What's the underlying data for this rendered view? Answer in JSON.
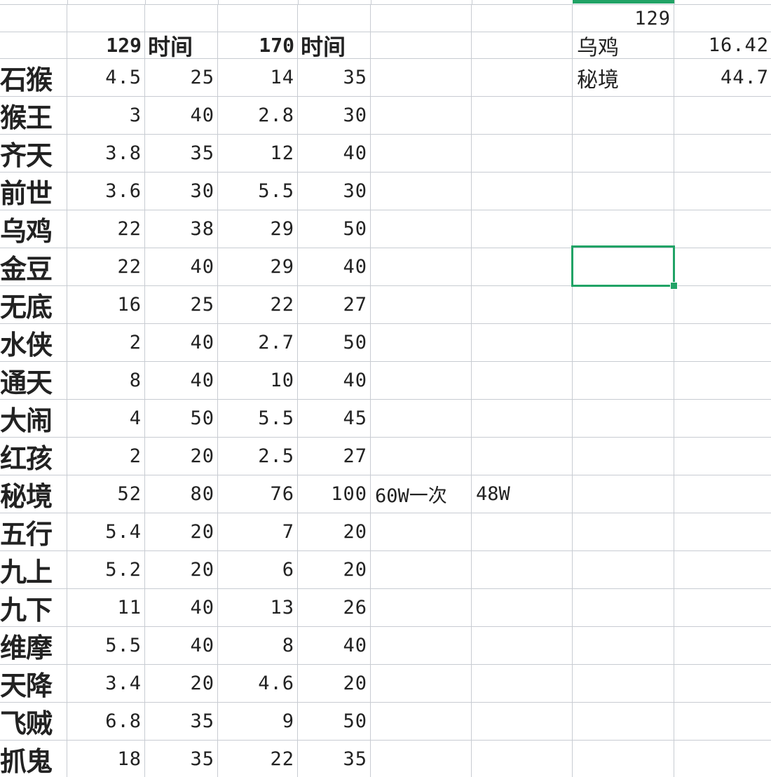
{
  "top_row": {
    "g1": "129"
  },
  "header": {
    "b": "129",
    "c": "时间",
    "d": "170",
    "e": "时间",
    "g_label": "乌鸡",
    "h_value": "16.42"
  },
  "rows": [
    {
      "name": "石猴",
      "v129": "4.5",
      "t129": "25",
      "v170": "14",
      "t170": "35"
    },
    {
      "name": "猴王",
      "v129": "3",
      "t129": "40",
      "v170": "2.8",
      "t170": "30"
    },
    {
      "name": "齐天",
      "v129": "3.8",
      "t129": "35",
      "v170": "12",
      "t170": "40"
    },
    {
      "name": "前世",
      "v129": "3.6",
      "t129": "30",
      "v170": "5.5",
      "t170": "30"
    },
    {
      "name": "乌鸡",
      "v129": "22",
      "t129": "38",
      "v170": "29",
      "t170": "50"
    },
    {
      "name": "金豆",
      "v129": "22",
      "t129": "40",
      "v170": "29",
      "t170": "40"
    },
    {
      "name": "无底",
      "v129": "16",
      "t129": "25",
      "v170": "22",
      "t170": "27"
    },
    {
      "name": "水侠",
      "v129": "2",
      "t129": "40",
      "v170": "2.7",
      "t170": "50"
    },
    {
      "name": "通天",
      "v129": "8",
      "t129": "40",
      "v170": "10",
      "t170": "40"
    },
    {
      "name": "大闹",
      "v129": "4",
      "t129": "50",
      "v170": "5.5",
      "t170": "45"
    },
    {
      "name": "红孩",
      "v129": "2",
      "t129": "20",
      "v170": "2.5",
      "t170": "27"
    },
    {
      "name": "秘境",
      "v129": "52",
      "t129": "80",
      "v170": "76",
      "t170": "100"
    },
    {
      "name": "五行",
      "v129": "5.4",
      "t129": "20",
      "v170": "7",
      "t170": "20"
    },
    {
      "name": "九上",
      "v129": "5.2",
      "t129": "20",
      "v170": "6",
      "t170": "20"
    },
    {
      "name": "九下",
      "v129": "11",
      "t129": "40",
      "v170": "13",
      "t170": "26"
    },
    {
      "name": "维摩",
      "v129": "5.5",
      "t129": "40",
      "v170": "8",
      "t170": "40"
    },
    {
      "name": "天降",
      "v129": "3.4",
      "t129": "20",
      "v170": "4.6",
      "t170": "20"
    },
    {
      "name": "飞贼",
      "v129": "6.8",
      "t129": "35",
      "v170": "9",
      "t170": "50"
    },
    {
      "name": "抓鬼",
      "v129": "18",
      "t129": "35",
      "v170": "22",
      "t170": "35"
    }
  ],
  "row1_side": {
    "g_label": "秘境",
    "h_value": "44.7"
  },
  "row12_notes": {
    "f": "60W一次",
    "g": "48W"
  },
  "colors": {
    "gridline": "#c8ccd2",
    "selection": "#21a366"
  }
}
